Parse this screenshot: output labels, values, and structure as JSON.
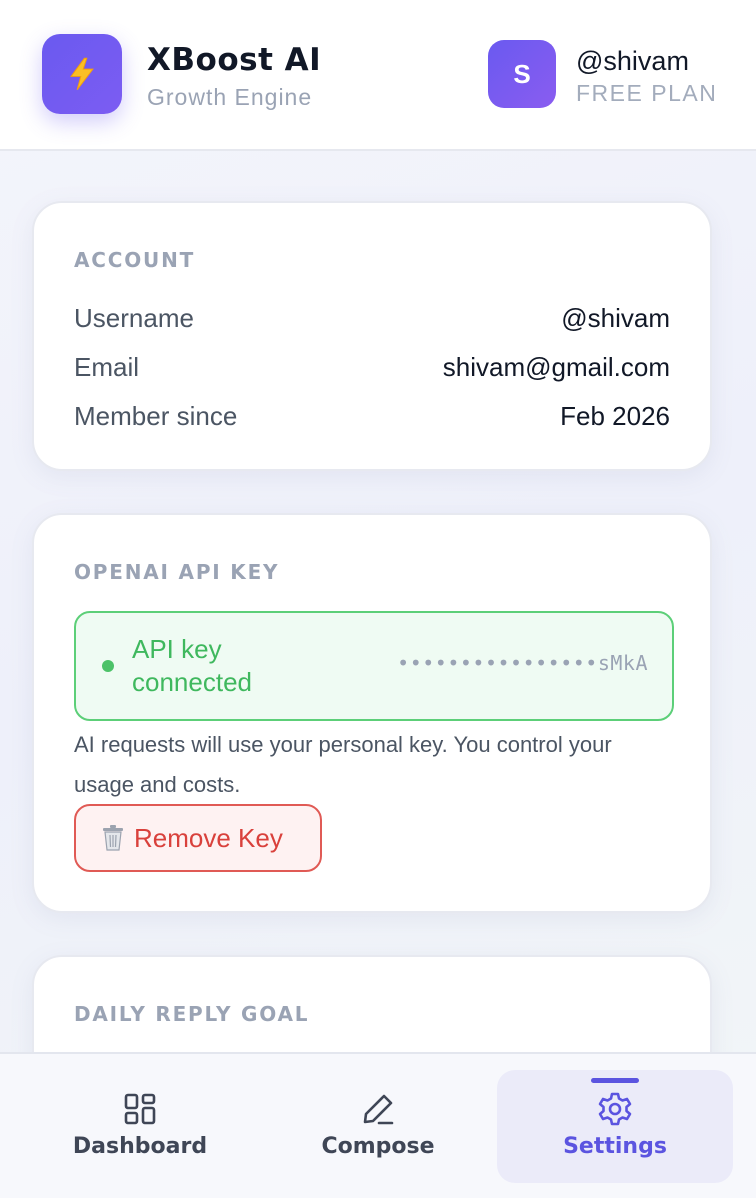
{
  "header": {
    "app_title": "XBoost AI",
    "app_subtitle": "Growth Engine",
    "logo_icon": "lightning-bolt-icon",
    "avatar_letter": "S",
    "user_handle": "@shivam",
    "user_plan": "FREE PLAN"
  },
  "account": {
    "title": "ACCOUNT",
    "rows": [
      {
        "label": "Username",
        "value": "@shivam"
      },
      {
        "label": "Email",
        "value": "shivam@gmail.com"
      },
      {
        "label": "Member since",
        "value": "Feb 2026"
      }
    ]
  },
  "api_key": {
    "title": "OPENAI API KEY",
    "status": "API key connected",
    "masked_key": "••••••••••••••••sMkA",
    "help_text": "AI requests will use your personal key. You control your usage and costs.",
    "remove_label": "Remove Key",
    "remove_icon": "trash-icon"
  },
  "daily_goal": {
    "title": "DAILY REPLY GOAL"
  },
  "nav": {
    "items": [
      {
        "label": "Dashboard",
        "icon": "dashboard-grid-icon"
      },
      {
        "label": "Compose",
        "icon": "pencil-icon"
      },
      {
        "label": "Settings",
        "icon": "gear-icon",
        "active": true
      }
    ]
  },
  "colors": {
    "accent": "#5b54e0",
    "brand_gradient_start": "#6a5af0",
    "success": "#3fb85e",
    "danger": "#d9413c"
  }
}
